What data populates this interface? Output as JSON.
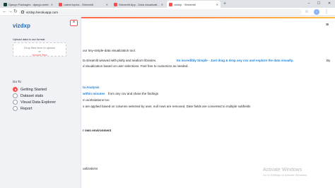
{
  "browser": {
    "tabs": [
      {
        "label": "Django Packages : django-webf...",
        "color": "#0c4b33"
      },
      {
        "label": "Latest topics - Streamlit",
        "color": "#ff4b4b"
      },
      {
        "label": "Streamlit App - Data visualizati...",
        "color": "#ff4b4b"
      },
      {
        "label": "vizdxp · Streamlit",
        "color": "#ff4b4b"
      }
    ],
    "url": "vizdxp.herokuapp.com",
    "icons": {
      "back": "back-arrow-icon",
      "forward": "forward-arrow-icon",
      "reload": "reload-icon",
      "star": "star-icon",
      "menu": "kebab-menu-icon"
    }
  },
  "sidebar": {
    "title": "vizdxp",
    "upload_label": "Upload data in csv format",
    "dropzone_line1": "Drop files here to upload",
    "dropzone_line2": "or",
    "dropzone_browse": "browse files",
    "goto_label": "Go To",
    "options": [
      {
        "label": "Getting Started",
        "selected": true
      },
      {
        "label": "Dataset stats",
        "selected": false
      },
      {
        "label": "Visual Data Explorer",
        "selected": false
      },
      {
        "label": "Report",
        "selected": false
      }
    ]
  },
  "main": {
    "heading_fragment": "W",
    "fragments": [
      {
        "text": "A",
        "cls": ""
      },
      {
        "text": "our tiny-simple-data visualization tool.",
        "cls": ""
      },
      {
        "text": "ta streamlit weaved with plotly and seaborn libraries.",
        "cls": ""
      },
      {
        "text": "Its incredibly Simple - Just drag & drop any csv and explore the data visually.",
        "cls": "link"
      },
      {
        "text": "By",
        "cls": ""
      },
      {
        "text": "d visualization based on user selections. Feel free to customize as needed.",
        "cls": ""
      },
      {
        "text": "Ke",
        "cls": "bold"
      },
      {
        "text": "ta Analysis",
        "cls": "link"
      },
      {
        "text": "within minutes",
        "cls": "link"
      },
      {
        "text": "from any csv and share the findings",
        "cls": ""
      },
      {
        "text": "m workstations too",
        "cls": ""
      },
      {
        "text": "s are applied based on columns selected by user, null rows are removed, Date fields are converted to multiple subfields",
        "cls": ""
      },
      {
        "text": "Try",
        "cls": "bold"
      },
      {
        "text": "r own environment",
        "cls": "bold"
      },
      {
        "text": "Pla",
        "cls": "bold"
      },
      {
        "text": "ualizations",
        "cls": ""
      }
    ],
    "watermark_title": "Activate Windows",
    "watermark_sub": "Go to Settings to activate Windows."
  },
  "colors": {
    "accent": "#ff4b4b",
    "link": "#1c83e1",
    "sidebar_bg": "#f0f2f6",
    "title": "#1c6bbf"
  }
}
